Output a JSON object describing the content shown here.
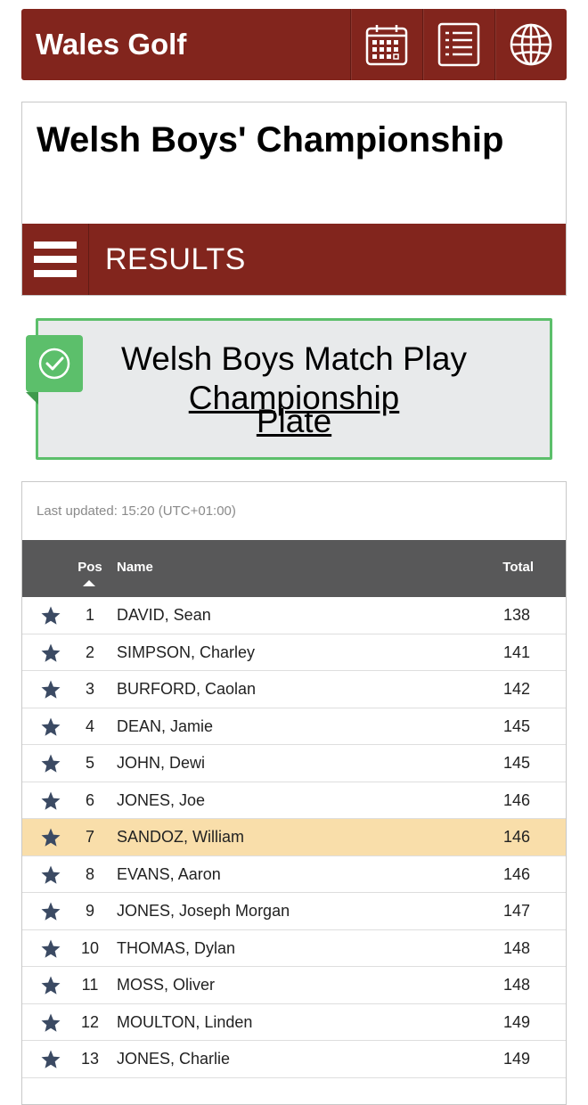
{
  "header": {
    "brand": "Wales Golf",
    "icons": [
      "calendar-icon",
      "list-icon",
      "globe-icon"
    ]
  },
  "championship": {
    "title": "Welsh Boys' Championship",
    "section_label": "RESULTS"
  },
  "event": {
    "line1": "Welsh Boys Match Play",
    "line2": "Championship",
    "line3": "Plate"
  },
  "results": {
    "last_updated": "Last updated: 15:20 (UTC+01:00)",
    "columns": {
      "pos": "Pos",
      "name": "Name",
      "total": "Total"
    },
    "rows": [
      {
        "pos": "1",
        "name": "DAVID, Sean",
        "total": "138"
      },
      {
        "pos": "2",
        "name": "SIMPSON, Charley",
        "total": "141"
      },
      {
        "pos": "3",
        "name": "BURFORD, Caolan",
        "total": "142"
      },
      {
        "pos": "4",
        "name": "DEAN, Jamie",
        "total": "145"
      },
      {
        "pos": "5",
        "name": "JOHN, Dewi",
        "total": "145"
      },
      {
        "pos": "6",
        "name": "JONES, Joe",
        "total": "146"
      },
      {
        "pos": "7",
        "name": "SANDOZ, William",
        "total": "146"
      },
      {
        "pos": "8",
        "name": "EVANS, Aaron",
        "total": "146"
      },
      {
        "pos": "9",
        "name": "JONES, Joseph Morgan",
        "total": "147"
      },
      {
        "pos": "10",
        "name": "THOMAS, Dylan",
        "total": "148"
      },
      {
        "pos": "11",
        "name": "MOSS, Oliver",
        "total": "148"
      },
      {
        "pos": "12",
        "name": "MOULTON, Linden",
        "total": "149"
      },
      {
        "pos": "13",
        "name": "JONES, Charlie",
        "total": "149"
      }
    ],
    "highlighted_pos": "7"
  },
  "colors": {
    "brand_red": "#82251d",
    "header_gray": "#585859",
    "success_green": "#5cbf6b",
    "highlight": "#f9deaa",
    "star": "#3b4a63"
  }
}
